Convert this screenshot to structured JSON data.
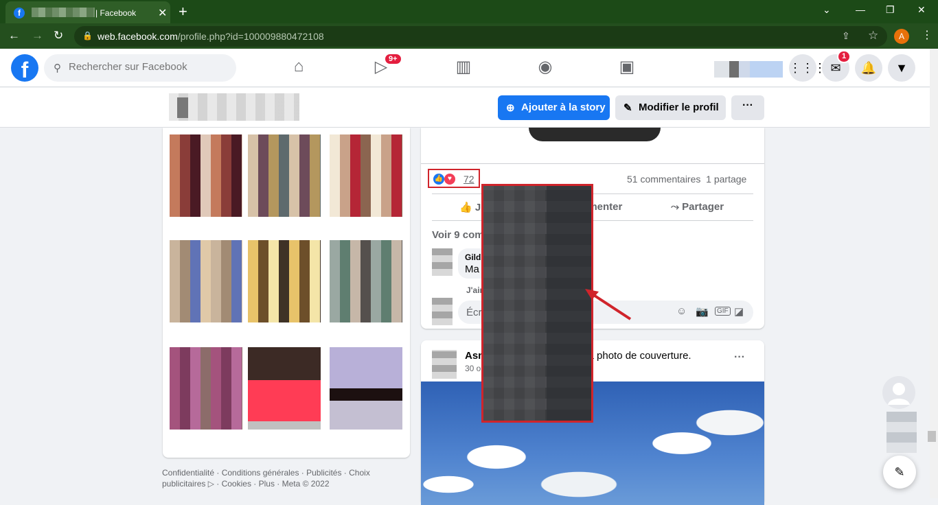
{
  "browser": {
    "tab_title": "| Facebook",
    "url_main": "web.facebook.com",
    "url_path": "/profile.php?id=100009880472108",
    "profile_initial": "A",
    "new_tab": "+",
    "tab_close": "✕"
  },
  "facebook": {
    "logo_letter": "f",
    "search_placeholder": "Rechercher sur Facebook",
    "watch_badge": "9+",
    "messenger_badge": "1"
  },
  "profile": {
    "add_story": "Ajouter à la story",
    "edit_profile": "Modifier le profil",
    "more": "···"
  },
  "footer": {
    "text": "Confidentialité · Conditions générales · Publicités · Choix publicitaires ▷ · Cookies · Plus · Meta © 2022"
  },
  "post1": {
    "reactions_count": "72",
    "comments": "51 commentaires",
    "shares": "1 partage",
    "like_label": "J",
    "comment_label": "mmenter",
    "share_label": "Partager",
    "see_comments": "Voir 9 com",
    "commenter_name": "Gild",
    "comment_text": "Ma",
    "comment_like": "J'aim",
    "compose_placeholder": "Écri"
  },
  "post2": {
    "author": "Asm",
    "action": "sa photo de couverture.",
    "date": "30 o",
    "more": "···"
  },
  "colors": {
    "accent": "#1877f2",
    "highlight_red": "#d0242b",
    "chrome_green": "#244f1e"
  }
}
